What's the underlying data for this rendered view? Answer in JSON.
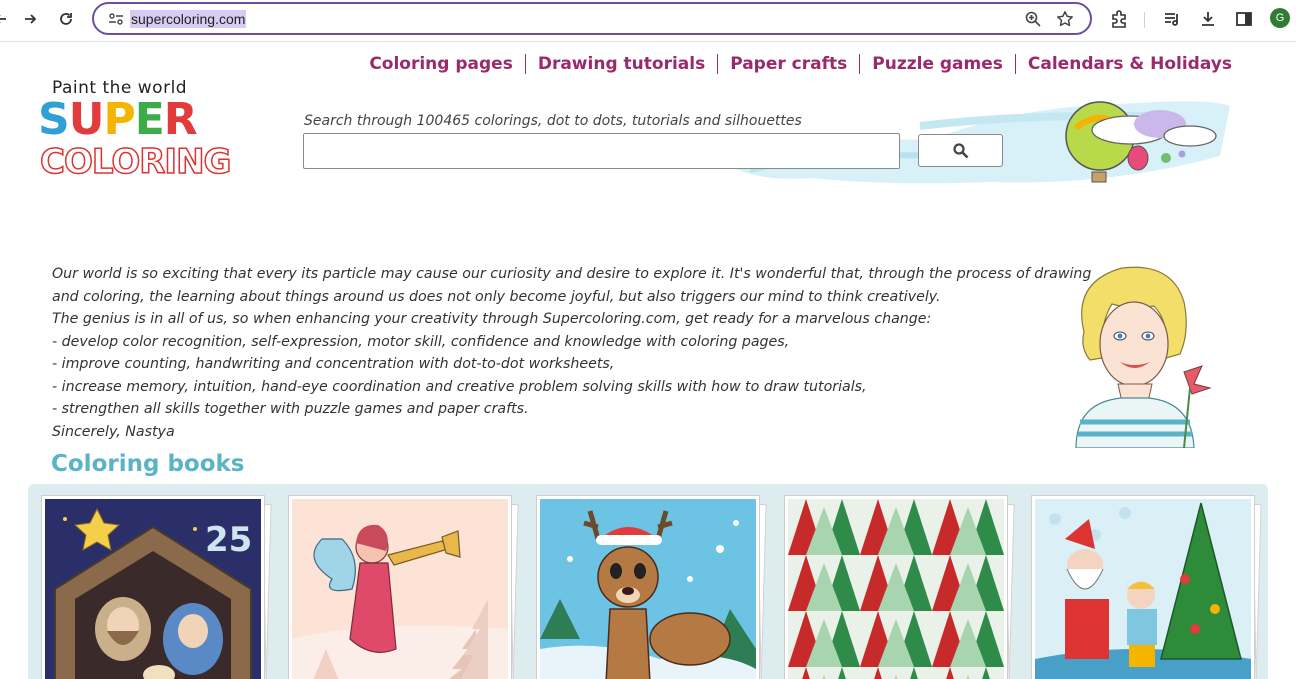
{
  "browser": {
    "url": "supercoloring.com",
    "profile_initial": "G",
    "icons": [
      "forward-icon",
      "reload-icon",
      "site-info-icon",
      "zoom-icon",
      "bookmark-star-icon",
      "extensions-icon",
      "media-icon",
      "download-icon",
      "sidepanel-icon"
    ]
  },
  "nav": {
    "items": [
      "Coloring pages",
      "Drawing tutorials",
      "Paper crafts",
      "Puzzle games",
      "Calendars & Holidays"
    ]
  },
  "logo": {
    "tagline": "Paint the world",
    "super": "SUPER",
    "coloring": "COLORING"
  },
  "search": {
    "label": "Search through 100465 colorings, dot to dots, tutorials and silhouettes",
    "value": "",
    "button_icon": "search-icon"
  },
  "intro": {
    "lines": [
      "Our world is so exciting that every its particle may cause our curiosity and desire to explore it. It's wonderful that, through the process of drawing",
      "and coloring, the learning about things around us does not only become joyful, but also triggers our mind to think creatively.",
      "The genius is in all of us, so when enhancing your creativity through Supercoloring.com, get ready for a marvelous change:",
      "- develop color recognition, self-expression, motor skill, confidence and knowledge with coloring pages,",
      "- improve counting, handwriting and concentration with dot-to-dot worksheets,",
      "- increase memory, intuition, hand-eye coordination and creative problem solving skills with how to draw tutorials,",
      "- strengthen all skills together with puzzle games and paper crafts.",
      "Sincerely, Nastya"
    ]
  },
  "books_section": {
    "title": "Coloring books",
    "advent_number": "25"
  },
  "colors": {
    "nav": "#9b2a6a",
    "section_title": "#5ab3c6",
    "panel": "#dcecef",
    "omnibox_border": "#6b4f9e"
  }
}
